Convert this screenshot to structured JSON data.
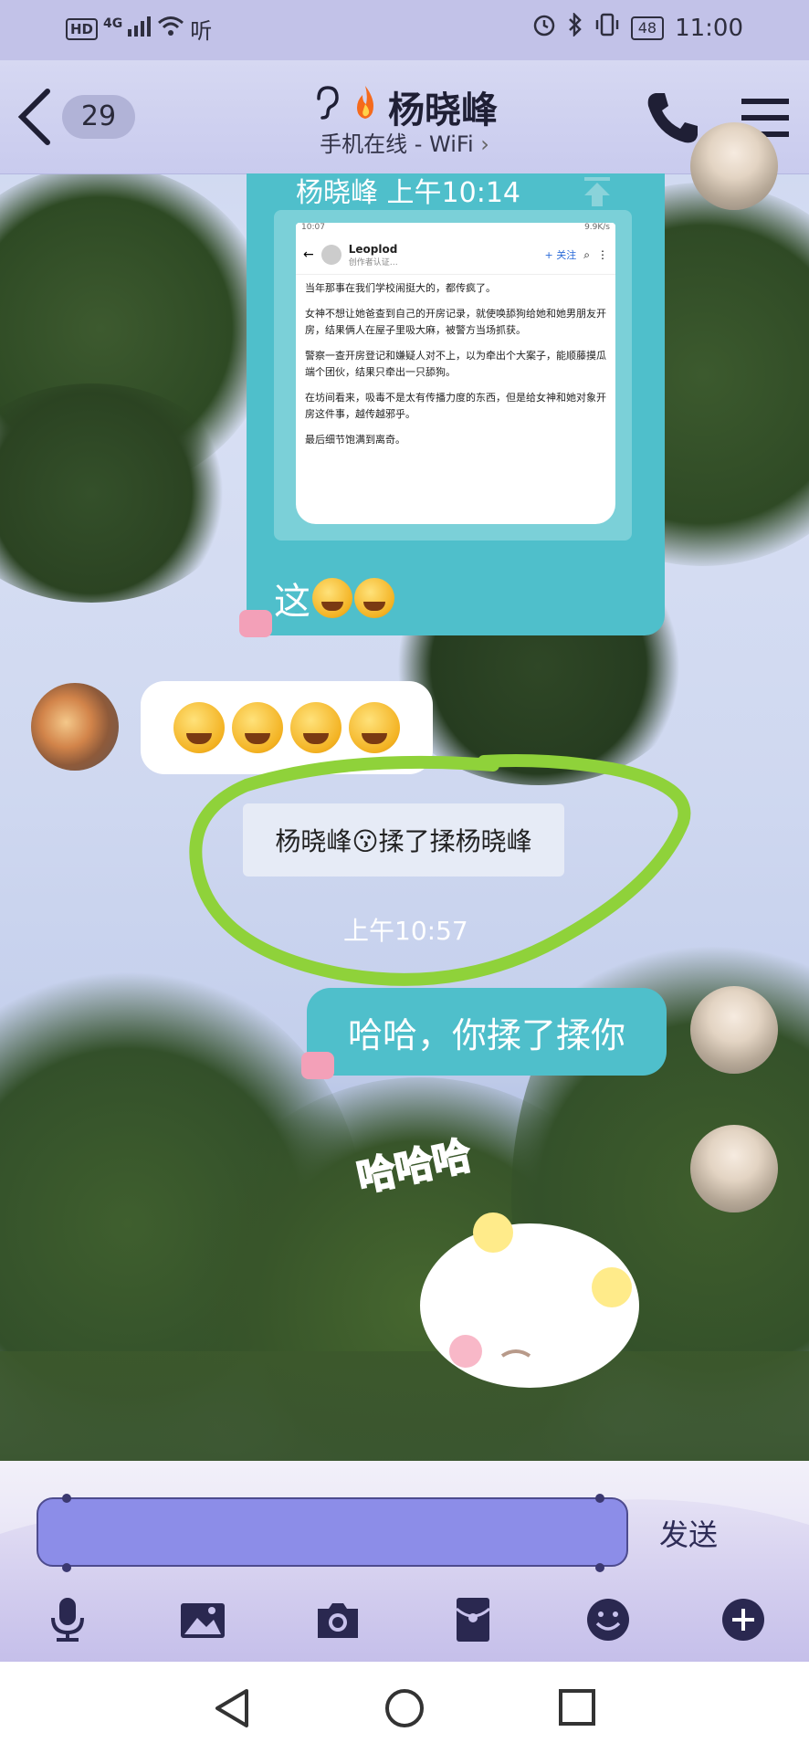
{
  "status_bar": {
    "left": {
      "hd": "HD",
      "network": "4G",
      "extra": "听"
    },
    "battery": "48",
    "time": "11:00"
  },
  "header": {
    "unread_count": "29",
    "title": "杨晓峰",
    "subtitle": "手机在线 - WiFi"
  },
  "messages": {
    "forwarded": {
      "header": "杨晓峰 上午10:14",
      "screenshot": {
        "status_time": "10:07",
        "status_right": "9.9K/s",
        "account_name": "Leoplod",
        "account_sub": "创作者认证…",
        "follow_label": "+ 关注",
        "paragraphs": [
          "当年那事在我们学校闹挺大的，都传疯了。",
          "女神不想让她爸查到自己的开房记录，就使唤舔狗给她和她男朋友开房，结果俩人在屋子里吸大麻，被警方当场抓获。",
          "警察一查开房登记和嫌疑人对不上，以为牵出个大案子，能顺藤摸瓜端个团伙，结果只牵出一只舔狗。",
          "在坊间看来，吸毒不是太有传播力度的东西，但是给女神和她对象开房这件事，越传越邪乎。",
          "最后细节饱满到离奇。"
        ]
      },
      "caption": "这"
    },
    "system_notice": "杨晓峰😗揉了揉杨晓峰",
    "system_time": "上午10:57",
    "my_reply": "哈哈，你揉了揉你",
    "sticker_text": "哈哈哈"
  },
  "input": {
    "send_label": "发送"
  },
  "toolbar": {
    "icons": [
      "microphone-icon",
      "image-icon",
      "camera-icon",
      "red-packet-icon",
      "emoji-icon",
      "plus-icon"
    ]
  },
  "colors": {
    "bubble_teal": "#4fbfcb",
    "input_fill": "#8c8de8",
    "nav_bg": "#c9cbee",
    "highlight_green": "#8fd23a"
  }
}
